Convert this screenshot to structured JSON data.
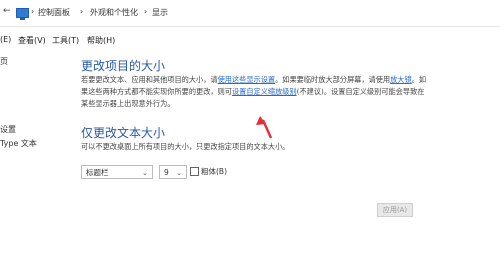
{
  "address_bar": {
    "breadcrumb": [
      "控制面板",
      "外观和个性化",
      "显示"
    ],
    "separator": "›"
  },
  "menu": {
    "edit": "(E)",
    "view": "查看(V)",
    "tools": "工具(T)",
    "help": "帮助(H)"
  },
  "sidebar": {
    "frag1": "页",
    "frag2": "设置",
    "frag3": "Type 文本"
  },
  "section1": {
    "title": "更改项目的大小",
    "para_1a": "若要更改文本、应用和其他项目的大小，请",
    "link_display_settings": "使用这些显示设置",
    "para_1b": "。如果要临时放大部分屏幕，请使用",
    "link_magnifier": "放大镜",
    "para_1c": "。如果这些两种方式都不能实现你所要的更改，则可",
    "link_custom_scaling": "设置自定义缩放级别",
    "para_1d": "(不建议)。设置自定义级别可能会导致在某些显示器上出现意外行为。"
  },
  "section2": {
    "title": "仅更改文本大小",
    "desc": "可以不更改桌面上所有项目的大小，只更改指定项目的文本大小。",
    "item_select": "标题栏",
    "size_select": "9",
    "bold_label": "粗体(B)"
  },
  "apply_button": "应用(A)",
  "colors": {
    "accent": "#2b59a8",
    "link": "#2a6ad0",
    "annotation_arrow": "#e0303a"
  }
}
